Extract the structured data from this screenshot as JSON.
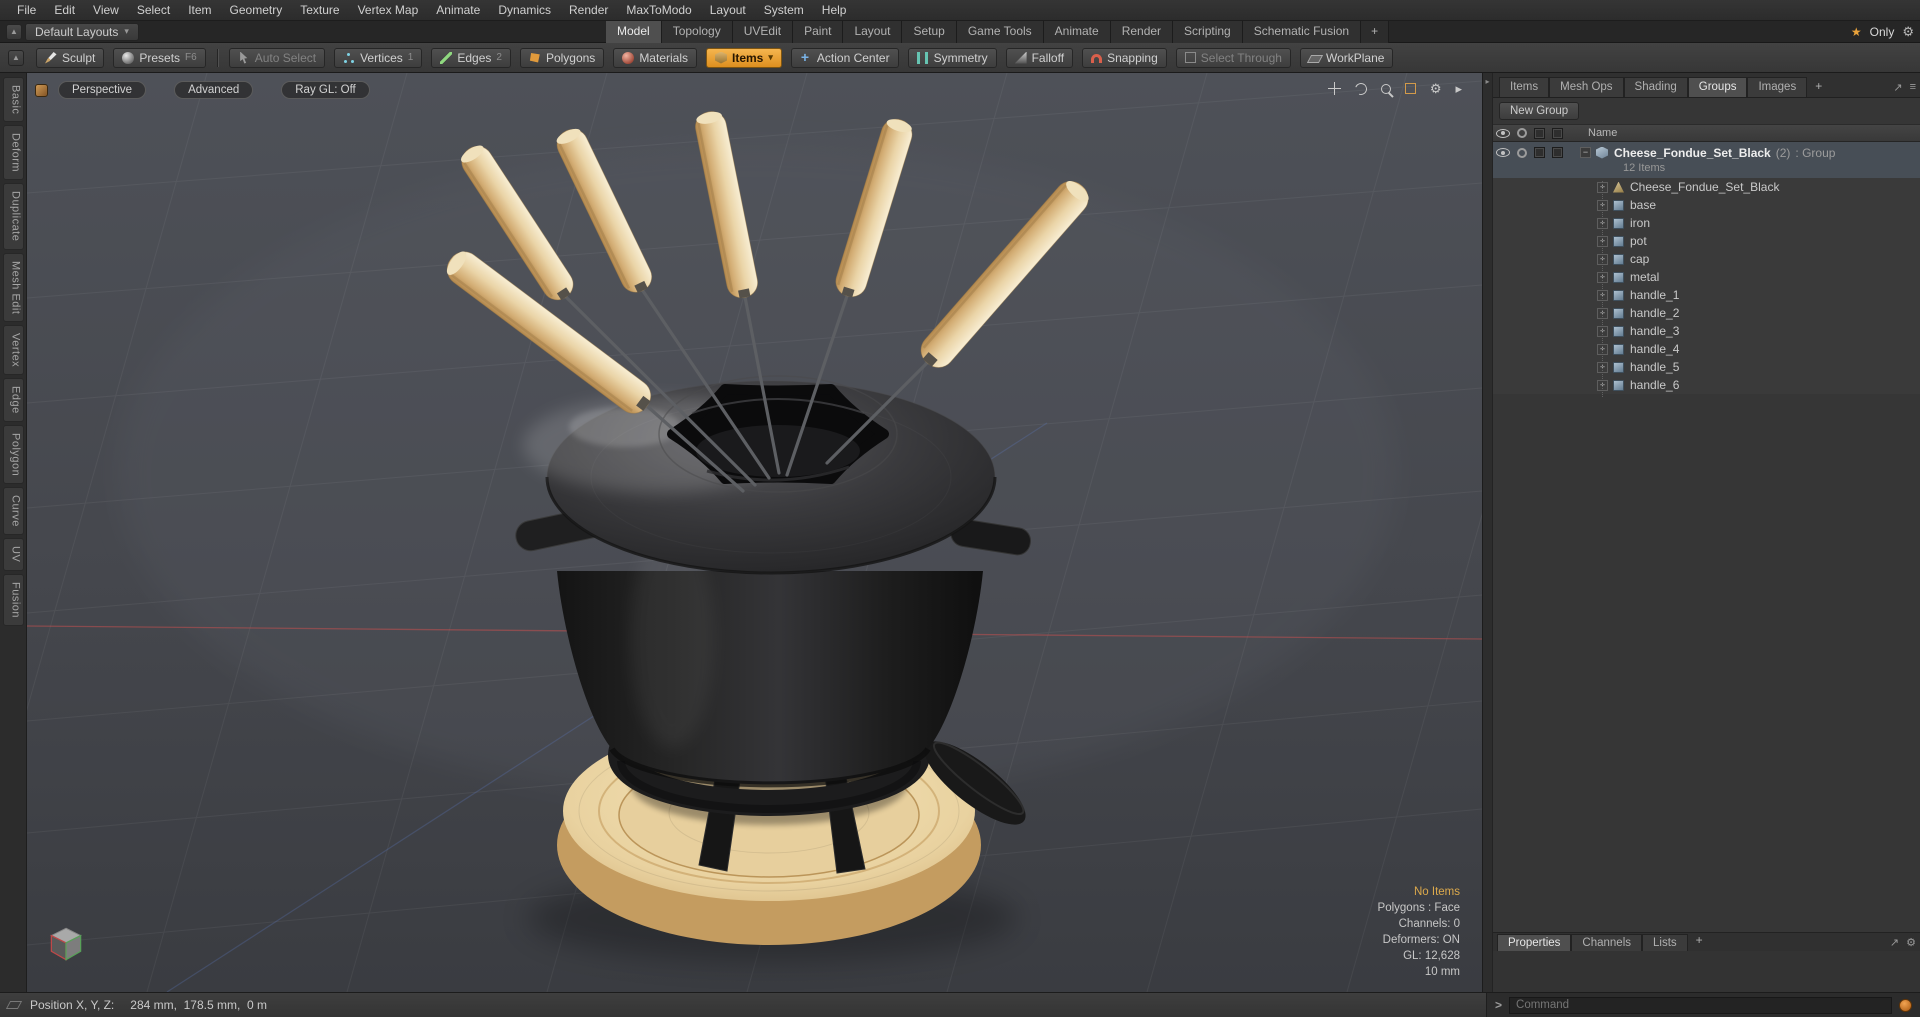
{
  "icons": {
    "gear": "⚙",
    "star": "★",
    "play": "▸",
    "collapse_right": "▸",
    "dropdown": "▾",
    "up": "▲",
    "expand": "↗",
    "menu": "≡",
    "plus": "+",
    "minus": "−"
  },
  "menubar": {
    "items": [
      "File",
      "Edit",
      "View",
      "Select",
      "Item",
      "Geometry",
      "Texture",
      "Vertex Map",
      "Animate",
      "Dynamics",
      "Render",
      "MaxToModo",
      "Layout",
      "System",
      "Help"
    ]
  },
  "tabbar": {
    "default_layouts": "Default Layouts",
    "tabs": [
      "Model",
      "Topology",
      "UVEdit",
      "Paint",
      "Layout",
      "Setup",
      "Game Tools",
      "Animate",
      "Render",
      "Scripting",
      "Schematic Fusion"
    ],
    "add_tab": "+",
    "only": "Only"
  },
  "toolbar": {
    "sculpt": "Sculpt",
    "presets": "Presets",
    "presets_hint": "F6",
    "auto_select": "Auto Select",
    "vertices": "Vertices",
    "vertices_hint": "1",
    "edges": "Edges",
    "edges_hint": "2",
    "polygons": "Polygons",
    "materials": "Materials",
    "items": "Items",
    "action_center": "Action Center",
    "symmetry": "Symmetry",
    "falloff": "Falloff",
    "snapping": "Snapping",
    "select_through": "Select Through",
    "workplane": "WorkPlane"
  },
  "left_sidebar": {
    "tabs": [
      "Basic",
      "Deform",
      "Duplicate",
      "Mesh Edit",
      "Vertex",
      "Edge",
      "Polygon",
      "Curve",
      "UV",
      "Fusion"
    ]
  },
  "viewport": {
    "mode_buttons": [
      "Perspective",
      "Advanced",
      "Ray GL: Off"
    ],
    "stats": {
      "items": "No Items",
      "polygons": "Polygons : Face",
      "channels": "Channels: 0",
      "deformers": "Deformers: ON",
      "gl": "GL: 12,628",
      "grid_size": "10 mm"
    }
  },
  "right_panel": {
    "tabs": [
      "Items",
      "Mesh Ops",
      "Shading",
      "Groups",
      "Images"
    ],
    "active_tab": "Groups",
    "add_tab": "+",
    "new_group_button": "New Group",
    "name_column": "Name",
    "group_row": {
      "name": "Cheese_Fondue_Set_Black",
      "badge": "(2)",
      "type": ": Group",
      "items_count": "12 Items"
    },
    "children": [
      "Cheese_Fondue_Set_Black",
      "base",
      "iron",
      "pot",
      "cap",
      "metal",
      "handle_1",
      "handle_2",
      "handle_3",
      "handle_4",
      "handle_5",
      "handle_6"
    ],
    "bottom_tabs": [
      "Properties",
      "Channels",
      "Lists"
    ],
    "bottom_add_tab": "+"
  },
  "command_bar": {
    "prompt": ">",
    "placeholder": "Command"
  },
  "statusbar": {
    "position_label": "Position X, Y, Z:",
    "position_value": "284 mm,  178.5 mm,  0 m"
  },
  "colors": {
    "accent": "#e9a23b",
    "selection_row": "#474e56",
    "warning_text": "#dca94c"
  }
}
